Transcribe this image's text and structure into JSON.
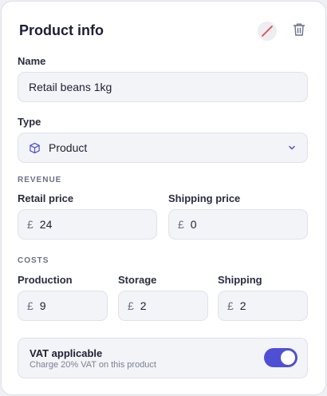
{
  "card": {
    "title": "Product info"
  },
  "name_field": {
    "label": "Name",
    "value": "Retail beans 1kg"
  },
  "type_field": {
    "label": "Type",
    "value": "Product",
    "icon": "box-icon"
  },
  "revenue": {
    "section_label": "REVENUE",
    "retail_price": {
      "label": "Retail price",
      "currency": "£",
      "value": "24"
    },
    "shipping_price": {
      "label": "Shipping price",
      "currency": "£",
      "value": "0"
    }
  },
  "costs": {
    "section_label": "COSTS",
    "production": {
      "label": "Production",
      "currency": "£",
      "value": "9"
    },
    "storage": {
      "label": "Storage",
      "currency": "£",
      "value": "2"
    },
    "shipping": {
      "label": "Shipping",
      "currency": "£",
      "value": "2"
    }
  },
  "vat": {
    "label": "VAT applicable",
    "description": "Charge 20% VAT on this product",
    "enabled": true
  },
  "colors": {
    "accent": "#4f4fd6",
    "field_bg": "#f3f4f8",
    "status_slash": "#e5484d"
  }
}
